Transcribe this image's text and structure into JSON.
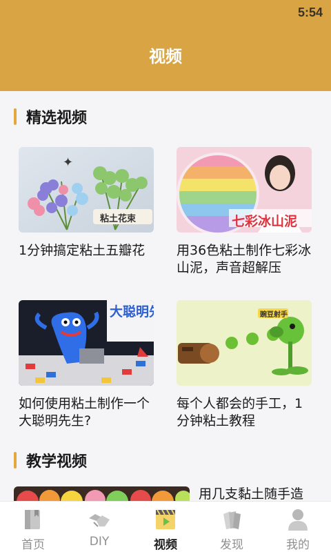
{
  "status_bar": {
    "time": "5:54"
  },
  "header": {
    "title": "视频"
  },
  "sections": {
    "featured": {
      "title": "精选视频"
    },
    "teaching": {
      "title": "教学视频"
    }
  },
  "featured_videos": [
    {
      "title": "1分钟搞定粘土五瓣花",
      "thumb_text": "粘土花束"
    },
    {
      "title": "用36色粘土制作七彩冰山泥，声音超解压",
      "thumb_text": "七彩冰山泥"
    },
    {
      "title": "如何使用粘土制作一个大聪明先生?",
      "thumb_text": "大聪明先生"
    },
    {
      "title": "每个人都会的手工，1分钟粘土教程",
      "thumb_text": "豌豆射手"
    }
  ],
  "teaching_videos": [
    {
      "title": "用几支黏土随手造"
    }
  ],
  "tabbar": {
    "items": [
      {
        "label": "首页",
        "icon": "book-icon",
        "active": false
      },
      {
        "label": "DIY",
        "icon": "handshake-icon",
        "active": false
      },
      {
        "label": "视频",
        "icon": "video-clapper-icon",
        "active": true
      },
      {
        "label": "发现",
        "icon": "discover-cards-icon",
        "active": false
      },
      {
        "label": "我的",
        "icon": "person-icon",
        "active": false
      }
    ]
  },
  "colors": {
    "header": "#d9a544",
    "accent": "#e0a83e",
    "background": "#f5f5f8"
  }
}
